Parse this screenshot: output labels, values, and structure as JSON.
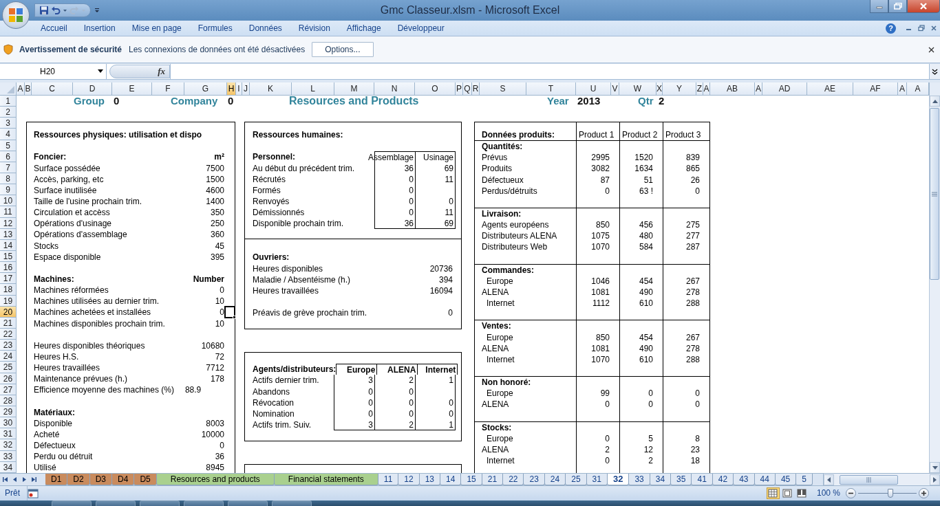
{
  "window": {
    "title": "Gmc Classeur.xlsm - Microsoft Excel"
  },
  "ribbon_tabs": [
    "Accueil",
    "Insertion",
    "Mise en page",
    "Formules",
    "Données",
    "Révision",
    "Affichage",
    "Développeur"
  ],
  "help_label": "?",
  "security_bar": {
    "title": "Avertissement de sécurité",
    "message": "Les connexions de données ont été désactivées",
    "button": "Options..."
  },
  "formula_bar": {
    "name_box": "H20",
    "function_label": "fx"
  },
  "columns": [
    {
      "label": "A",
      "selected": false
    },
    {
      "label": "B",
      "selected": false
    },
    {
      "label": "C",
      "selected": false
    },
    {
      "label": "D",
      "selected": false
    },
    {
      "label": "E",
      "selected": false
    },
    {
      "label": "F",
      "selected": false
    },
    {
      "label": "G",
      "selected": false
    },
    {
      "label": "H",
      "selected": true
    },
    {
      "label": "I",
      "selected": false
    },
    {
      "label": "J",
      "selected": false
    },
    {
      "label": "K",
      "selected": false
    },
    {
      "label": "L",
      "selected": false
    },
    {
      "label": "M",
      "selected": false
    },
    {
      "label": "N",
      "selected": false
    },
    {
      "label": "O",
      "selected": false
    },
    {
      "label": "P",
      "selected": false
    },
    {
      "label": "Q",
      "selected": false
    },
    {
      "label": "R",
      "selected": false
    },
    {
      "label": "S",
      "selected": false
    },
    {
      "label": "T",
      "selected": false
    },
    {
      "label": "U",
      "selected": false
    },
    {
      "label": "V",
      "selected": false
    },
    {
      "label": "W",
      "selected": false
    },
    {
      "label": "X",
      "selected": false
    },
    {
      "label": "Y",
      "selected": false
    },
    {
      "label": "Z",
      "selected": false
    },
    {
      "label": "A",
      "selected": false
    },
    {
      "label": "AB",
      "selected": false
    },
    {
      "label": "A",
      "selected": false
    },
    {
      "label": "AD",
      "selected": false
    },
    {
      "label": "AE",
      "selected": false
    },
    {
      "label": "AF",
      "selected": false
    },
    {
      "label": "A",
      "selected": false
    },
    {
      "label": "A",
      "selected": false
    }
  ],
  "rows": [
    {
      "label": "1",
      "selected": false
    },
    {
      "label": "2",
      "selected": false
    },
    {
      "label": "3",
      "selected": false
    },
    {
      "label": "4",
      "selected": false
    },
    {
      "label": "5",
      "selected": false
    },
    {
      "label": "6",
      "selected": false
    },
    {
      "label": "7",
      "selected": false
    },
    {
      "label": "8",
      "selected": false
    },
    {
      "label": "9",
      "selected": false
    },
    {
      "label": "10",
      "selected": false
    },
    {
      "label": "11",
      "selected": false
    },
    {
      "label": "12",
      "selected": false
    },
    {
      "label": "13",
      "selected": false
    },
    {
      "label": "14",
      "selected": false
    },
    {
      "label": "15",
      "selected": false
    },
    {
      "label": "16",
      "selected": false
    },
    {
      "label": "17",
      "selected": false
    },
    {
      "label": "18",
      "selected": false
    },
    {
      "label": "19",
      "selected": false
    },
    {
      "label": "20",
      "selected": true
    },
    {
      "label": "21",
      "selected": false
    },
    {
      "label": "22",
      "selected": false
    },
    {
      "label": "23",
      "selected": false
    },
    {
      "label": "24",
      "selected": false
    },
    {
      "label": "25",
      "selected": false
    },
    {
      "label": "26",
      "selected": false
    },
    {
      "label": "27",
      "selected": false
    },
    {
      "label": "28",
      "selected": false
    },
    {
      "label": "29",
      "selected": false
    },
    {
      "label": "30",
      "selected": false
    },
    {
      "label": "31",
      "selected": false
    },
    {
      "label": "32",
      "selected": false
    },
    {
      "label": "33",
      "selected": false
    },
    {
      "label": "34",
      "selected": false
    }
  ],
  "title_row": [
    {
      "kind": "label",
      "text": "Group"
    },
    {
      "kind": "value",
      "text": "0"
    },
    {
      "kind": "label",
      "text": "Company"
    },
    {
      "kind": "value",
      "text": "0"
    },
    {
      "kind": "title",
      "text": "Resources and Products"
    },
    {
      "kind": "label",
      "text": "Year"
    },
    {
      "kind": "value",
      "text": "2013"
    },
    {
      "kind": "label",
      "text": "Qtr"
    },
    {
      "kind": "value",
      "text": "2"
    }
  ],
  "physical_panel": {
    "lines": [
      {
        "kind": "heading",
        "label": "Ressources physiques: utilisation et dispo"
      },
      {
        "kind": "blank"
      },
      {
        "kind": "heading",
        "label": "Foncier:",
        "value": "m²"
      },
      {
        "kind": "row",
        "label": "Surface possédée",
        "value": "7500"
      },
      {
        "kind": "row",
        "label": "Accès, parking, etc",
        "value": "1500"
      },
      {
        "kind": "row",
        "label": "Surface inutilisée",
        "value": "4600"
      },
      {
        "kind": "row",
        "label": "Taille de l'usine prochain trim.",
        "value": "1400"
      },
      {
        "kind": "row",
        "label": "Circulation et accèss",
        "value": "350"
      },
      {
        "kind": "row",
        "label": "Opérations d'usinage",
        "value": "250"
      },
      {
        "kind": "row",
        "label": "Opérations d'assemblage",
        "value": "360"
      },
      {
        "kind": "row",
        "label": "Stocks",
        "value": "45"
      },
      {
        "kind": "row",
        "label": "Espace disponible",
        "value": "395"
      },
      {
        "kind": "blank"
      },
      {
        "kind": "heading",
        "label": "Machines:",
        "value": "Number"
      },
      {
        "kind": "row",
        "label": "Machines réformées",
        "value": "0"
      },
      {
        "kind": "row",
        "label": "Machines utilisées au dernier trim.",
        "value": "10"
      },
      {
        "kind": "row",
        "label": "Machines achetées et installées",
        "value": "0"
      },
      {
        "kind": "row",
        "label": "Machines disponibles prochain trim.",
        "value": "10"
      },
      {
        "kind": "blank"
      },
      {
        "kind": "row",
        "label": "Heures disponibles théoriques",
        "value": "10680"
      },
      {
        "kind": "row",
        "label": "Heures H.S.",
        "value": "72"
      },
      {
        "kind": "row",
        "label": "Heures travaillées",
        "value": "7712"
      },
      {
        "kind": "row",
        "label": "Maintenance prévues (h.)",
        "value": "178"
      },
      {
        "kind": "inline",
        "label": "Efficience moyenne des machines (%)",
        "value": "88.9"
      },
      {
        "kind": "blank"
      },
      {
        "kind": "heading",
        "label": "Matériaux:"
      },
      {
        "kind": "row",
        "label": "Disponible",
        "value": "8003"
      },
      {
        "kind": "row",
        "label": "Acheté",
        "value": "10000"
      },
      {
        "kind": "row",
        "label": "Défectueux",
        "value": "0"
      },
      {
        "kind": "row",
        "label": "Perdu ou détruit",
        "value": "36"
      },
      {
        "kind": "row",
        "label": "Utilisé",
        "value": "8945"
      }
    ]
  },
  "hr_boxes": [
    {
      "title": "Ressources humaines:",
      "sections": [
        {
          "kind": "table",
          "heading": "Personnel:",
          "columns": [
            "Assemblage",
            "Usinage"
          ],
          "rows": [
            {
              "label": "Au début du précédent trim.",
              "values": [
                "36",
                "69"
              ]
            },
            {
              "label": "Récrutés",
              "values": [
                "0",
                "11"
              ]
            },
            {
              "label": "Formés",
              "values": [
                "0"
              ]
            },
            {
              "label": "Renvoyés",
              "values": [
                "0",
                "0"
              ]
            },
            {
              "label": "Démissionnés",
              "values": [
                "0",
                "11"
              ]
            },
            {
              "label": "Disponible prochain trim.",
              "values": [
                "36",
                "69"
              ]
            }
          ]
        },
        {
          "kind": "list",
          "heading": "Ouvriers:",
          "rows": [
            {
              "kind": "row",
              "label": "Heures disponibles",
              "value": "20736"
            },
            {
              "kind": "row",
              "label": "Maladie / Absentéisme (h.)",
              "value": "394"
            },
            {
              "kind": "row",
              "label": "Heures travaillées",
              "value": "16094"
            },
            {
              "kind": "blank"
            },
            {
              "kind": "row",
              "label": "Préavis de grève prochain trim.",
              "value": "0"
            }
          ]
        }
      ]
    },
    {
      "sections": [
        {
          "kind": "channel_table",
          "heading": "Agents/distributeurs:",
          "columns": [
            "Europe",
            "ALENA",
            "Internet"
          ],
          "rows": [
            {
              "label": "Actifs dernier trim.",
              "values": [
                "3",
                "2",
                "1"
              ]
            },
            {
              "label": "Abandons",
              "values": [
                "0",
                "0"
              ]
            },
            {
              "label": "Révocation",
              "values": [
                "0",
                "0",
                "0"
              ]
            },
            {
              "label": "Nomination",
              "values": [
                "0",
                "0",
                "0"
              ]
            },
            {
              "label": "Actifs trim. Suiv.",
              "values": [
                "3",
                "2",
                "1"
              ]
            }
          ]
        }
      ]
    }
  ],
  "products": {
    "heading": "Données produits:",
    "columns": [
      "Product 1",
      "Product 2",
      "Product 3"
    ],
    "sections": [
      {
        "heading": "Quantités:",
        "rows": [
          {
            "label": "Prévus",
            "indent": false,
            "values": [
              "2995",
              "1520",
              "839"
            ]
          },
          {
            "label": "Produits",
            "indent": false,
            "values": [
              "3082",
              "1634",
              "865"
            ]
          },
          {
            "label": "Défectueux",
            "indent": false,
            "values": [
              "87",
              "51",
              "26"
            ]
          },
          {
            "label": "Perdus/détruits",
            "indent": false,
            "values": [
              "0",
              "63 !",
              "0"
            ]
          }
        ]
      },
      {
        "heading": "Livraison:",
        "rows": [
          {
            "label": "Agents européens",
            "indent": false,
            "values": [
              "850",
              "456",
              "275"
            ]
          },
          {
            "label": "Distributeurs ALENA",
            "indent": false,
            "values": [
              "1075",
              "480",
              "277"
            ]
          },
          {
            "label": "Distributeurs Web",
            "indent": false,
            "values": [
              "1070",
              "584",
              "287"
            ]
          }
        ]
      },
      {
        "heading": "Commandes:",
        "rows": [
          {
            "label": "Europe",
            "indent": true,
            "values": [
              "1046",
              "454",
              "267"
            ]
          },
          {
            "label": "ALENA",
            "indent": false,
            "values": [
              "1081",
              "490",
              "278"
            ]
          },
          {
            "label": "Internet",
            "indent": true,
            "values": [
              "1112",
              "610",
              "288"
            ]
          }
        ]
      },
      {
        "heading": "Ventes:",
        "rows": [
          {
            "label": "Europe",
            "indent": true,
            "values": [
              "850",
              "454",
              "267"
            ]
          },
          {
            "label": "ALENA",
            "indent": false,
            "values": [
              "1081",
              "490",
              "278"
            ]
          },
          {
            "label": "Internet",
            "indent": true,
            "values": [
              "1070",
              "610",
              "288"
            ]
          }
        ]
      },
      {
        "heading": "Non honoré:",
        "rows": [
          {
            "label": "Europe",
            "indent": true,
            "values": [
              "99",
              "0",
              "0"
            ]
          },
          {
            "label": "ALENA",
            "indent": false,
            "values": [
              "0",
              "0",
              "0"
            ]
          }
        ]
      },
      {
        "heading": "Stocks:",
        "rows": [
          {
            "label": "Europe",
            "indent": true,
            "values": [
              "0",
              "5",
              "8"
            ]
          },
          {
            "label": "ALENA",
            "indent": false,
            "values": [
              "2",
              "12",
              "23"
            ]
          },
          {
            "label": "Internet",
            "indent": true,
            "values": [
              "0",
              "2",
              "18"
            ]
          }
        ]
      }
    ]
  },
  "sheet_tabs": [
    {
      "label": "D1",
      "color": "#c98b5d",
      "selected": false
    },
    {
      "label": "D2",
      "color": "#c98b5d",
      "selected": false
    },
    {
      "label": "D3",
      "color": "#c98b5d",
      "selected": false
    },
    {
      "label": "D4",
      "color": "#c98b5d",
      "selected": false
    },
    {
      "label": "D5",
      "color": "#c98b5d",
      "selected": false
    },
    {
      "label": "Resources and products",
      "color": "#a9d08e",
      "selected": false
    },
    {
      "label": "Financial statements",
      "color": "#a9d08e",
      "selected": false
    },
    {
      "label": "11",
      "selected": false
    },
    {
      "label": "12",
      "selected": false
    },
    {
      "label": "13",
      "selected": false
    },
    {
      "label": "14",
      "selected": false
    },
    {
      "label": "15",
      "selected": false
    },
    {
      "label": "21",
      "selected": false
    },
    {
      "label": "22",
      "selected": false
    },
    {
      "label": "23",
      "selected": false
    },
    {
      "label": "24",
      "selected": false
    },
    {
      "label": "25",
      "selected": false
    },
    {
      "label": "31",
      "selected": false
    },
    {
      "label": "32",
      "selected": true
    },
    {
      "label": "33",
      "selected": false
    },
    {
      "label": "34",
      "selected": false
    },
    {
      "label": "35",
      "selected": false
    },
    {
      "label": "41",
      "selected": false
    },
    {
      "label": "42",
      "selected": false
    },
    {
      "label": "43",
      "selected": false
    },
    {
      "label": "44",
      "selected": false
    },
    {
      "label": "45",
      "selected": false
    },
    {
      "label": "5",
      "selected": false
    }
  ],
  "status_bar": {
    "text": "Prêt",
    "views": [
      {
        "kind": "normal",
        "selected": true
      },
      {
        "kind": "page_layout",
        "selected": false
      },
      {
        "kind": "page_break",
        "selected": false
      }
    ],
    "zoom": "100 %",
    "zoom_slider": {
      "level": 0.55
    }
  }
}
